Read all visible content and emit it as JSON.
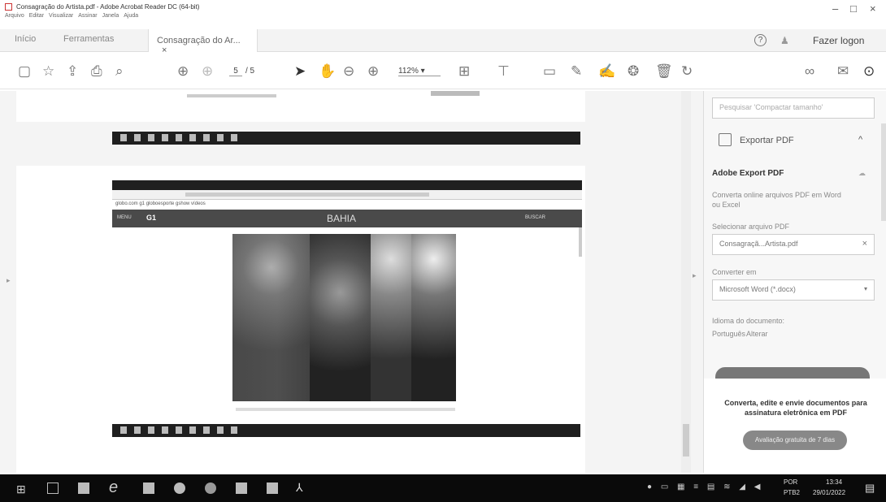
{
  "window": {
    "title": "Consagração do Artista.pdf - Adobe Acrobat Reader DC (64-bit)",
    "menus": [
      "Arquivo",
      "Editar",
      "Visualizar",
      "Assinar",
      "Janela",
      "Ajuda"
    ]
  },
  "tabs": {
    "inicio": "Início",
    "ferramentas": "Ferramentas",
    "doc": "Consagração do Ar...",
    "close": "×",
    "login": "Fazer logon",
    "help": "?"
  },
  "toolbar": {
    "page_current": "5",
    "page_total": "/ 5",
    "zoom": "112%"
  },
  "doc": {
    "embedded_site": "BAHIA",
    "embedded_menu": "MENU",
    "embedded_logo": "G1",
    "embedded_search": "BUSCAR",
    "nav_links": "globo.com   g1   globoesporte   gshow   vídeos"
  },
  "panel": {
    "search_placeholder": "Pesquisar 'Compactar tamanho'",
    "export_title": "Exportar PDF",
    "adobe_export": "Adobe Export PDF",
    "export_desc": "Converta online arquivos PDF em Word ou Excel",
    "select_label": "Selecionar arquivo PDF",
    "selected_file": "Consagraçã...Artista.pdf",
    "convert_label": "Converter em",
    "convert_value": "Microsoft Word (*.docx)",
    "lang_label": "Idioma do documento:",
    "lang_value": "Português",
    "lang_change": "Alterar",
    "promo": "Converta, edite e envie documentos para assinatura eletrônica em PDF",
    "trial_button": "Avaliação gratuita de 7 dias"
  },
  "taskbar": {
    "lang": "POR",
    "lang2": "PTB2",
    "time": "13:34",
    "date": "29/01/2022"
  }
}
